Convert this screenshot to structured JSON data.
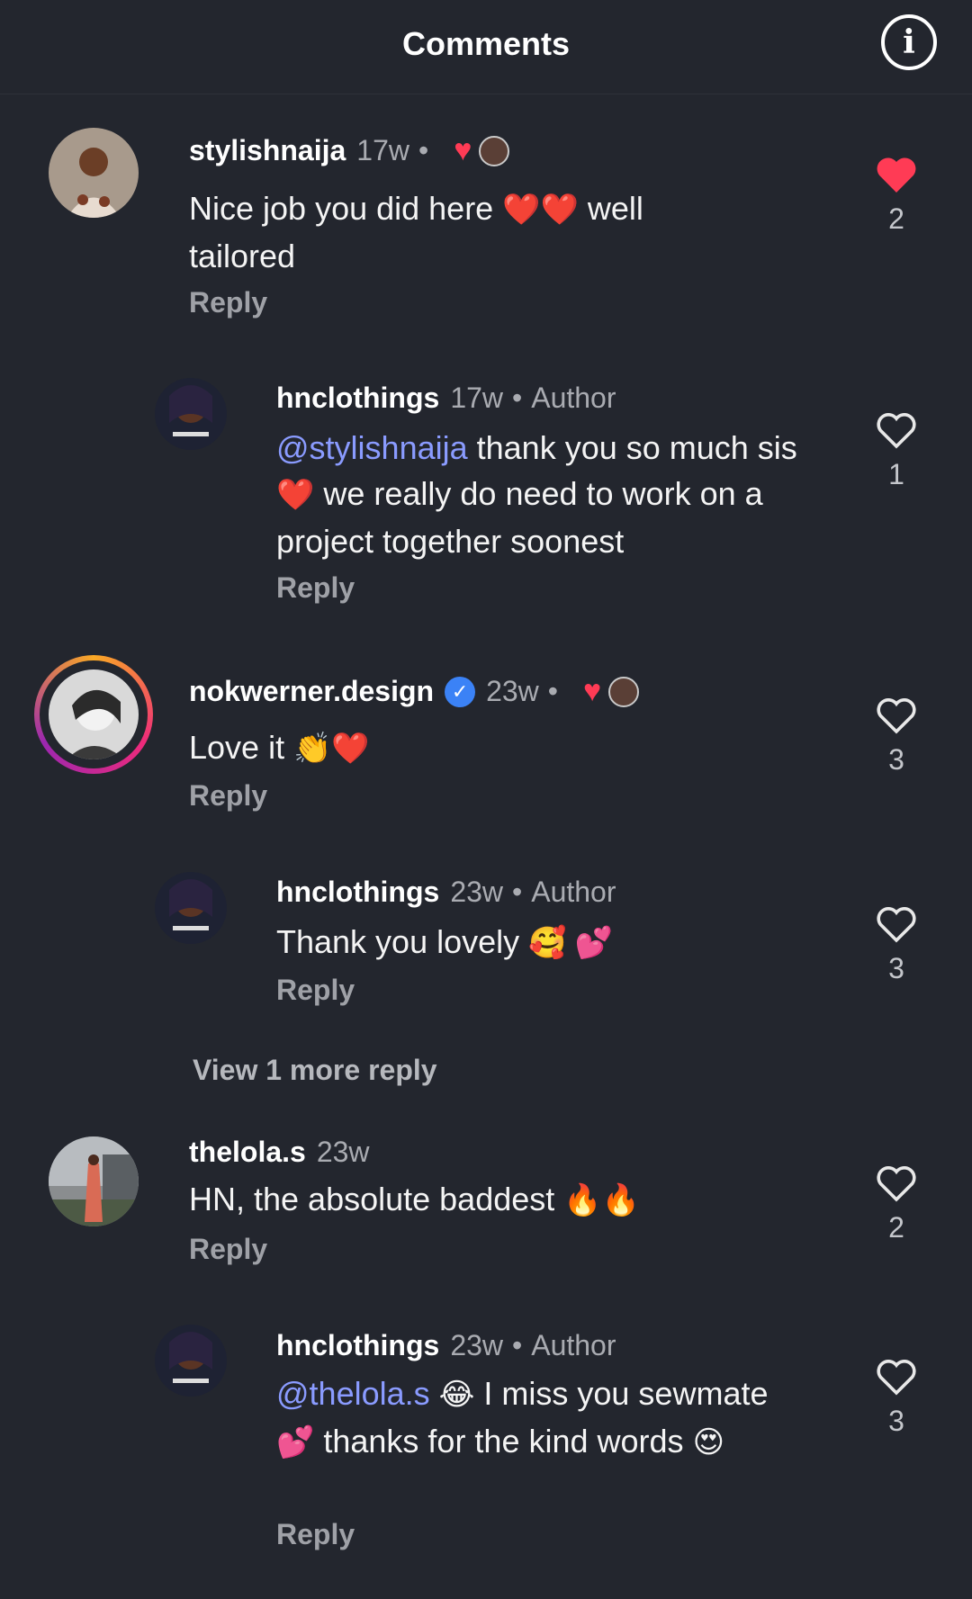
{
  "header": {
    "title": "Comments",
    "info_icon": "i"
  },
  "comments": [
    {
      "username": "stylishnaija",
      "time": "17w",
      "author_badge": "",
      "text_parts": [
        "Nice job you did here ",
        "❤️❤️",
        " well tailored"
      ],
      "reply": "Reply",
      "likes": "2",
      "liked": true
    },
    {
      "username": "hnclothings",
      "time": "17w",
      "author_badge": "Author",
      "mention": "@stylishnaija",
      "text_parts": [
        " thank you so much sis ",
        "❤️",
        " we really do need to work on a project together soonest"
      ],
      "reply": "Reply",
      "likes": "1",
      "liked": false
    },
    {
      "username": "nokwerner.design",
      "time": "23w",
      "author_badge": "",
      "text_parts": [
        "Love it ",
        "👏❤️"
      ],
      "reply": "Reply",
      "likes": "3",
      "liked": false
    },
    {
      "username": "hnclothings",
      "time": "23w",
      "author_badge": "Author",
      "text_parts": [
        "Thank you lovely ",
        "🥰 💕"
      ],
      "reply": "Reply",
      "likes": "3",
      "liked": false
    },
    {
      "username": "thelola.s",
      "time": "23w",
      "author_badge": "",
      "text_parts": [
        "HN, the absolute baddest ",
        "🔥🔥"
      ],
      "reply": "Reply",
      "likes": "2",
      "liked": false
    },
    {
      "username": "hnclothings",
      "time": "23w",
      "author_badge": "Author",
      "mention": "@thelola.s",
      "text_parts": [
        " ",
        "😂",
        " I miss you sewmate ",
        "💕",
        " thanks for the kind words ",
        "😍"
      ],
      "reply": "Reply",
      "likes": "3",
      "liked": false
    }
  ],
  "view_more": "View 1 more reply",
  "colors": {
    "background": "#23262e",
    "mention": "#8a9bff",
    "like_red": "#ff3b55"
  },
  "icons": {
    "liked": "heart-filled-icon",
    "unliked": "heart-outline-icon",
    "verified": "verified-badge-icon"
  }
}
